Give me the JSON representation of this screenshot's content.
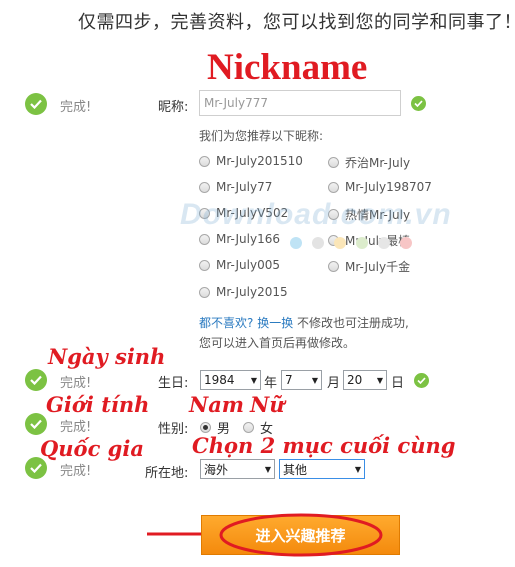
{
  "header": {
    "headline": "仅需四步，完善资料，您可以找到您的同学和同事了！"
  },
  "annotations": {
    "nickname": "Nickname",
    "birthday": "Ngày sinh",
    "gender": "Giới tính",
    "gender_male": "Nam",
    "gender_female": "Nữ",
    "country": "Quốc gia",
    "pick_last": "Chọn 2 mục cuối cùng"
  },
  "status_done": "完成!",
  "nickname": {
    "label": "昵称:",
    "value": "Mr-July777",
    "suggest_intro": "我们为您推荐以下昵称:",
    "suggestions": [
      "Mr-July201510",
      "乔治Mr-July",
      "Mr-July77",
      "Mr-July198707",
      "Mr-JulyV502",
      "热情Mr-July",
      "Mr-July166",
      "Mr-July最棒",
      "Mr-July005",
      "Mr-July千金",
      "Mr-July2015"
    ],
    "dislike_text": "都不喜欢?",
    "refresh_link": "换一换",
    "note_line1": " 不修改也可注册成功,",
    "note_line2": "您可以进入首页后再做修改。"
  },
  "birthday": {
    "label": "生日:",
    "year": "1984",
    "year_unit": "年",
    "month": "7",
    "month_unit": "月",
    "day": "20",
    "day_unit": "日"
  },
  "gender": {
    "label": "性别:",
    "male": "男",
    "female": "女",
    "selected": "男"
  },
  "location": {
    "label": "所在地:",
    "country": "海外",
    "region": "其他"
  },
  "watermark": "Download.com.vn",
  "submit": {
    "label": "进入兴趣推荐"
  },
  "colors": {
    "annotation_red": "#e01b22",
    "check_green": "#7cc243",
    "button_orange": "#f7941d",
    "link_blue": "#2a7ac0"
  }
}
